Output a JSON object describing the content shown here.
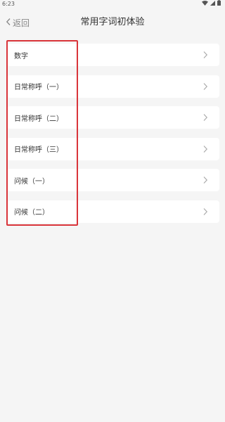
{
  "status_bar": {
    "time": "6:23",
    "icons": [
      "wifi-icon",
      "signal-icon",
      "battery-icon"
    ]
  },
  "nav": {
    "back_label": "返回",
    "title": "常用字词初体验"
  },
  "list": {
    "items": [
      {
        "label": "数字"
      },
      {
        "label": "日常称呼（一）"
      },
      {
        "label": "日常称呼（二）"
      },
      {
        "label": "日常称呼（三）"
      },
      {
        "label": "问候（一）"
      },
      {
        "label": "问候（二）"
      }
    ]
  },
  "colors": {
    "background": "#f5f5f5",
    "card": "#ffffff",
    "highlight": "#d9343a",
    "muted": "#888888"
  }
}
